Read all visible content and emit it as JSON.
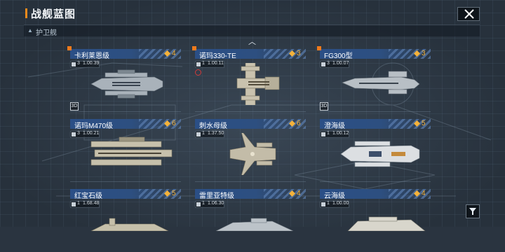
{
  "header": {
    "title": "战舰蓝图"
  },
  "subbar": {
    "label": "护卫舰"
  },
  "ships": [
    {
      "name": "卡利莱恩级",
      "count": "4",
      "level": "3",
      "value": "1.00.39",
      "badge": "3D"
    },
    {
      "name": "诺玛330-TE",
      "count": "3",
      "level": "1",
      "value": "1.00.11"
    },
    {
      "name": "FG300型",
      "count": "3",
      "level": "3",
      "value": "1.00.07",
      "badge": "3D"
    },
    {
      "name": "诺玛M470级",
      "count": "6",
      "level": "3",
      "value": "1.00.21"
    },
    {
      "name": "刺水母级",
      "count": "6",
      "level": "1",
      "value": "1.37.50"
    },
    {
      "name": "澄海级",
      "count": "5",
      "level": "1",
      "value": "1.00.12"
    },
    {
      "name": "红宝石级",
      "count": "5",
      "level": "1",
      "value": "1.68.48"
    },
    {
      "name": "雷里亚特级",
      "count": "4",
      "level": "1",
      "value": "1.06.30"
    },
    {
      "name": "云海级",
      "count": "4",
      "level": "1",
      "value": "1.00.00"
    }
  ],
  "colors": {
    "accent": "#f08a1c",
    "name_bar": "#2b4f86",
    "count": "#f5b23a"
  },
  "icons": {
    "close": "close-icon",
    "filter": "filter-icon",
    "collapse": "chevron-up-icon"
  }
}
